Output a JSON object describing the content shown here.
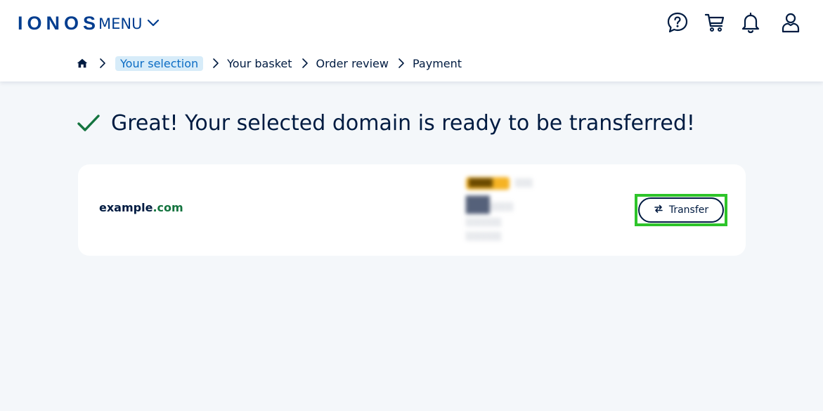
{
  "header": {
    "logo": "IONOS",
    "menu_label": "MENU",
    "icons": [
      "help-icon",
      "cart-icon",
      "bell-icon",
      "user-icon"
    ]
  },
  "breadcrumb": {
    "items": [
      "Your selection",
      "Your basket",
      "Order review",
      "Payment"
    ],
    "active_index": 0
  },
  "main": {
    "success_message": "Great! Your selected domain is ready to be transferred!",
    "domain": {
      "name": "example",
      "tld": ".com"
    },
    "price": {
      "promo_badge": "blurred",
      "promo_note": "blurred",
      "amount": "blurred",
      "period": "blurred",
      "vat_note": "blurred",
      "term_note": "blurred"
    },
    "transfer_button": "Transfer"
  },
  "colors": {
    "brand": "#003d8f",
    "text": "#001b41",
    "success_green": "#14743f",
    "active_crumb_bg": "#d7ecf9",
    "active_crumb_text": "#0b6cc4",
    "highlight": "#2ec42a",
    "page_bg": "#f4f7fa"
  }
}
